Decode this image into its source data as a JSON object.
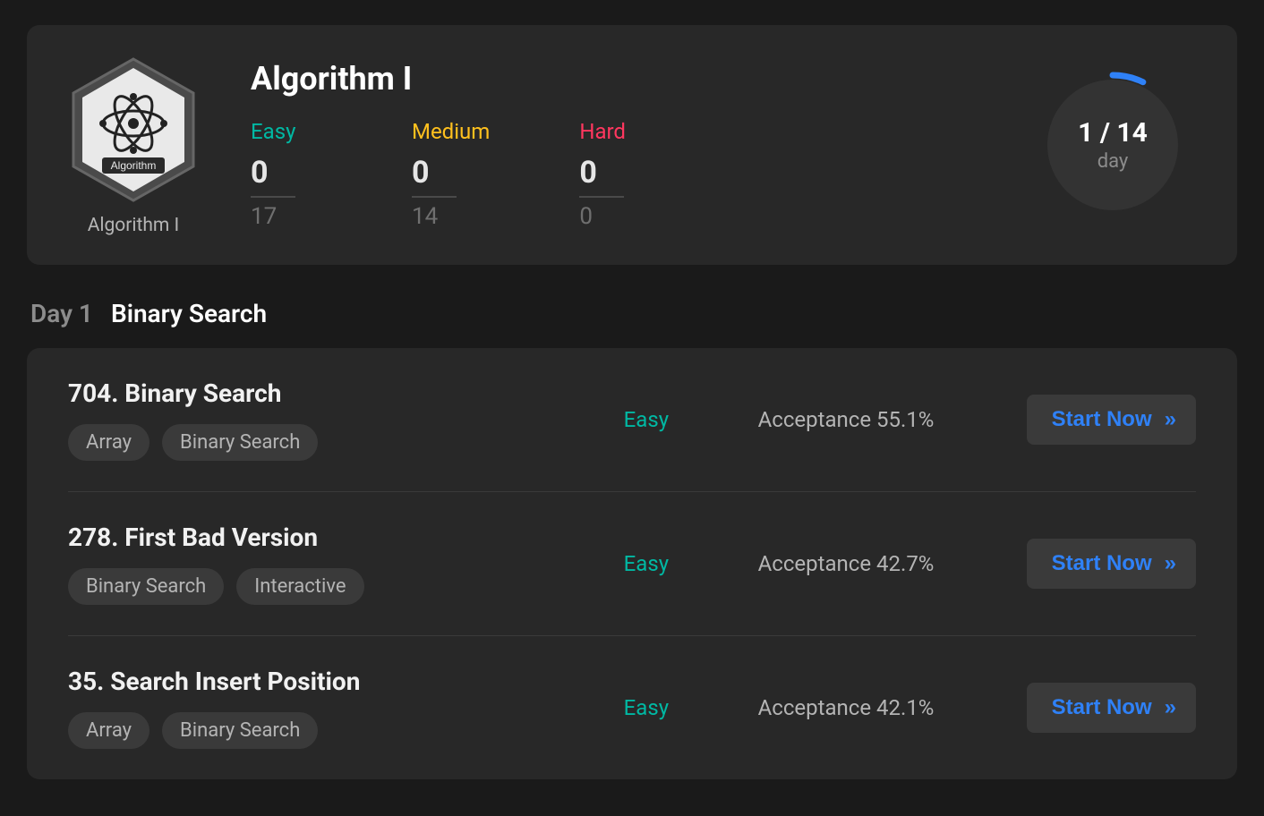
{
  "header": {
    "title": "Algorithm I",
    "badge_caption": "Algorithm I",
    "badge_inner_text": "Algorithm",
    "stats": [
      {
        "label": "Easy",
        "class": "stat-easy",
        "solved": "0",
        "total": "17"
      },
      {
        "label": "Medium",
        "class": "stat-medium",
        "solved": "0",
        "total": "14"
      },
      {
        "label": "Hard",
        "class": "stat-hard",
        "solved": "0",
        "total": "0"
      }
    ],
    "progress": {
      "text": "1 / 14",
      "unit": "day",
      "percent": 7.14
    }
  },
  "section": {
    "day": "Day 1",
    "topic": "Binary Search"
  },
  "problems": [
    {
      "title": "704. Binary Search",
      "tags": [
        "Array",
        "Binary Search"
      ],
      "difficulty": "Easy",
      "acceptance_label": "Acceptance 55.1%",
      "button": "Start Now"
    },
    {
      "title": "278. First Bad Version",
      "tags": [
        "Binary Search",
        "Interactive"
      ],
      "difficulty": "Easy",
      "acceptance_label": "Acceptance 42.7%",
      "button": "Start Now"
    },
    {
      "title": "35. Search Insert Position",
      "tags": [
        "Array",
        "Binary Search"
      ],
      "difficulty": "Easy",
      "acceptance_label": "Acceptance 42.1%",
      "button": "Start Now"
    }
  ]
}
